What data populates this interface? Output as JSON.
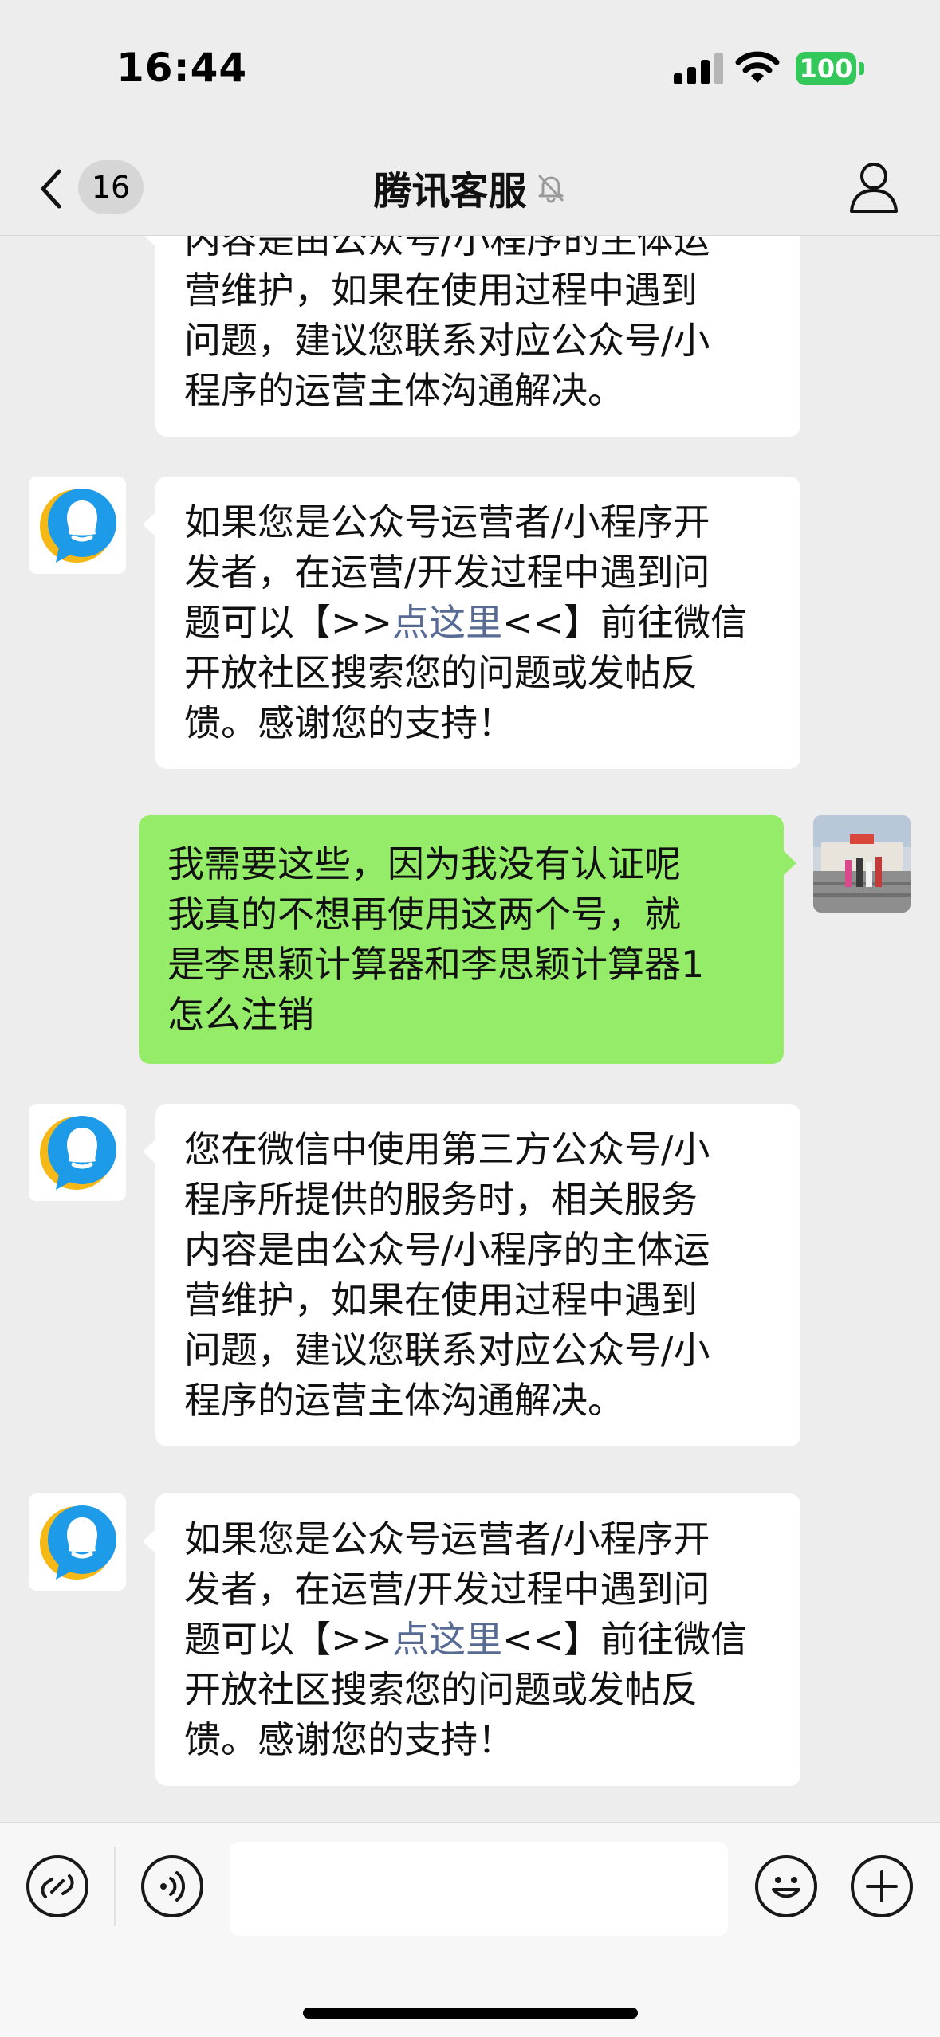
{
  "status_bar": {
    "time": "16:44",
    "battery": "100"
  },
  "nav": {
    "unread_count": "16",
    "title": "腾讯客服"
  },
  "messages": [
    {
      "side": "left",
      "text": "内容是由公众号/小程序的主体运\n营维护，如果在使用过程中遇到\n问题，建议您联系对应公众号/小\n程序的运营主体沟通解决。"
    },
    {
      "side": "left",
      "text_before": "如果您是公众号运营者/小程序开\n发者，在运营/开发过程中遇到问\n题可以【>>",
      "link": "点这里",
      "text_after": "<<】前往微信\n开放社区搜索您的问题或发帖反\n馈。感谢您的支持！"
    },
    {
      "side": "right",
      "text": "我需要这些，因为我没有认证呢\n我真的不想再使用这两个号，就\n是李思颖计算器和李思颖计算器1\n怎么注销"
    },
    {
      "side": "left",
      "text": "您在微信中使用第三方公众号/小\n程序所提供的服务时，相关服务\n内容是由公众号/小程序的主体运\n营维护，如果在使用过程中遇到\n问题，建议您联系对应公众号/小\n程序的运营主体沟通解决。"
    },
    {
      "side": "left",
      "text_before": "如果您是公众号运营者/小程序开\n发者，在运营/开发过程中遇到问\n题可以【>>",
      "link": "点这里",
      "text_after": "<<】前往微信\n开放社区搜索您的问题或发帖反\n馈。感谢您的支持！"
    }
  ],
  "colors": {
    "background": "#ededed",
    "bubble_self": "#95ec69",
    "bubble_other": "#ffffff",
    "link": "#576b95",
    "battery": "#34c759"
  },
  "input": {
    "value": "",
    "placeholder": ""
  },
  "icons": {
    "back": "chevron-left-icon",
    "mute": "bell-slash-icon",
    "profile": "person-icon",
    "service_link": "link-icon",
    "voice": "voice-icon",
    "emoji": "emoji-icon",
    "more": "plus-icon"
  }
}
